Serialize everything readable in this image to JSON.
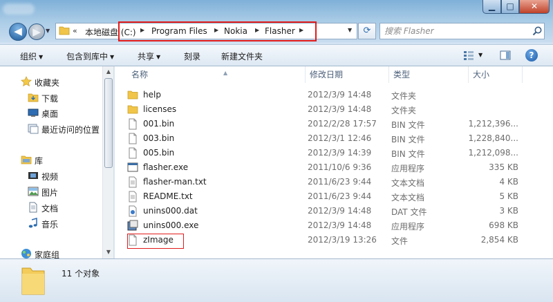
{
  "window": {
    "controls": {
      "minimize": "▁",
      "maximize": "□",
      "close": "✕"
    }
  },
  "address": {
    "chevron": "«",
    "segments": [
      "本地磁盘 (C:)",
      "Program Files",
      "Nokia",
      "Flasher"
    ],
    "refresh_icon": "refresh-icon"
  },
  "search": {
    "placeholder": "搜索 Flasher"
  },
  "toolbar": {
    "organize": "组织",
    "include_in_library": "包含到库中",
    "share": "共享",
    "burn": "刻录",
    "new_folder": "新建文件夹",
    "help": "?"
  },
  "navpane": {
    "items": [
      {
        "label": "收藏夹",
        "icon": "star-icon"
      },
      {
        "label": "下载",
        "icon": "download-folder-icon"
      },
      {
        "label": "桌面",
        "icon": "desktop-icon"
      },
      {
        "label": "最近访问的位置",
        "icon": "recent-places-icon"
      },
      {
        "label": "库",
        "icon": "library-icon"
      },
      {
        "label": "视频",
        "icon": "video-icon"
      },
      {
        "label": "图片",
        "icon": "pictures-icon"
      },
      {
        "label": "文档",
        "icon": "documents-icon"
      },
      {
        "label": "音乐",
        "icon": "music-icon"
      },
      {
        "label": "家庭组",
        "icon": "homegroup-icon"
      }
    ]
  },
  "columns": {
    "name": "名称",
    "date": "修改日期",
    "type": "类型",
    "size": "大小"
  },
  "files": [
    {
      "name": "help",
      "date": "2012/3/9 14:48",
      "type": "文件夹",
      "size": "",
      "icon": "folder-icon"
    },
    {
      "name": "licenses",
      "date": "2012/3/9 14:48",
      "type": "文件夹",
      "size": "",
      "icon": "folder-icon"
    },
    {
      "name": "001.bin",
      "date": "2012/2/28 17:57",
      "type": "BIN 文件",
      "size": "1,212,396...",
      "icon": "file-icon"
    },
    {
      "name": "003.bin",
      "date": "2012/3/1 12:46",
      "type": "BIN 文件",
      "size": "1,228,840...",
      "icon": "file-icon"
    },
    {
      "name": "005.bin",
      "date": "2012/3/9 14:39",
      "type": "BIN 文件",
      "size": "1,212,098...",
      "icon": "file-icon"
    },
    {
      "name": "flasher.exe",
      "date": "2011/10/6 9:36",
      "type": "应用程序",
      "size": "335 KB",
      "icon": "application-icon"
    },
    {
      "name": "flasher-man.txt",
      "date": "2011/6/23 9:44",
      "type": "文本文档",
      "size": "4 KB",
      "icon": "text-file-icon"
    },
    {
      "name": "README.txt",
      "date": "2011/6/23 9:44",
      "type": "文本文档",
      "size": "5 KB",
      "icon": "text-file-icon"
    },
    {
      "name": "unins000.dat",
      "date": "2012/3/9 14:48",
      "type": "DAT 文件",
      "size": "3 KB",
      "icon": "dat-file-icon"
    },
    {
      "name": "unins000.exe",
      "date": "2012/3/9 14:48",
      "type": "应用程序",
      "size": "698 KB",
      "icon": "installer-icon"
    },
    {
      "name": "zImage",
      "date": "2012/3/19 13:26",
      "type": "文件",
      "size": "2,854 KB",
      "icon": "file-icon"
    }
  ],
  "details": {
    "count": "11 个对象"
  },
  "colors": {
    "highlight": "#e21a1a",
    "accent": "#1a5aa6"
  }
}
